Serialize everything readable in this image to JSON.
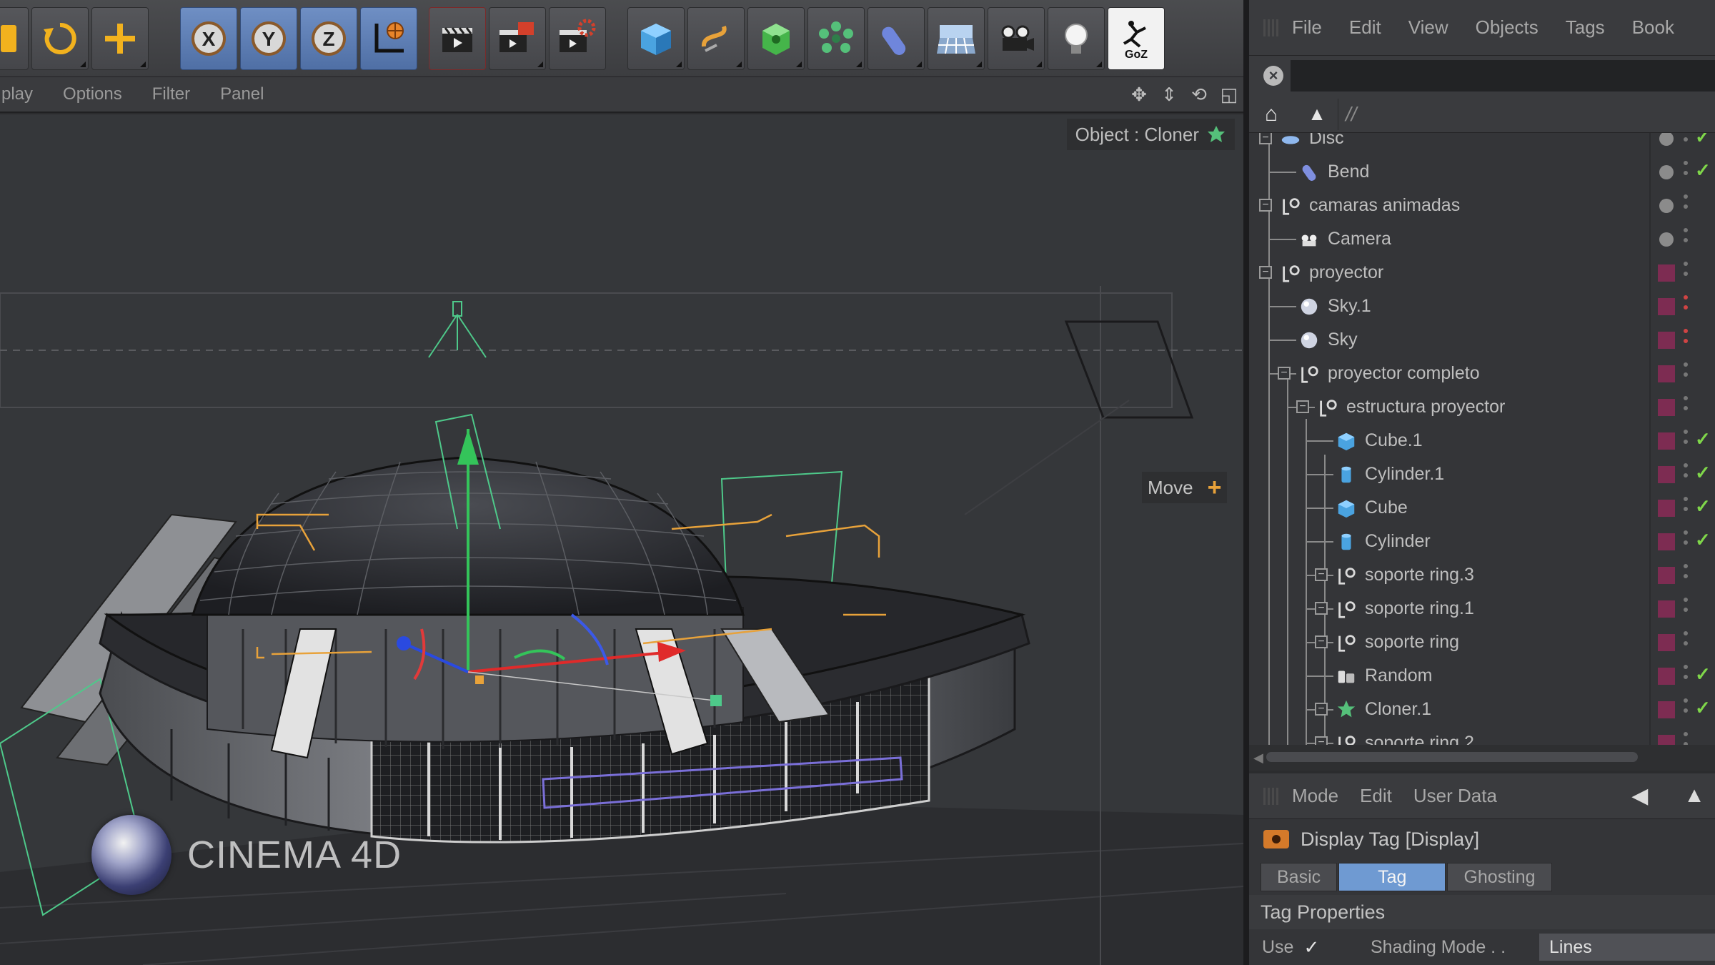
{
  "toolbar": {
    "groups": [
      {
        "items": [
          "model-tool-icon",
          "rotate-icon",
          "move-plus-icon"
        ]
      },
      {
        "items": [
          "x-axis-lock-icon",
          "y-axis-lock-icon",
          "z-axis-lock-icon",
          "world-coordinate-icon"
        ]
      },
      {
        "items": [
          "render-view-icon",
          "render-picture-viewer-icon",
          "render-settings-icon"
        ]
      },
      {
        "items": [
          "cube-object-icon",
          "spline-pen-icon",
          "nurbs-icon",
          "mograph-cloner-icon",
          "deformer-bend-icon",
          "scene-floor-icon",
          "camera-icon",
          "light-icon",
          "goz-icon"
        ]
      }
    ],
    "active_items": [
      "x-axis-lock-icon",
      "y-axis-lock-icon",
      "z-axis-lock-icon",
      "world-coordinate-icon"
    ],
    "goz_label": "GoZ"
  },
  "viewport_menu": {
    "items": [
      "play",
      "Options",
      "Filter",
      "Panel"
    ]
  },
  "viewport": {
    "object_label": "Object : Cloner",
    "hud_label": "Move",
    "logo_text": "CINEMA 4D"
  },
  "object_manager": {
    "menu": [
      "File",
      "Edit",
      "View",
      "Objects",
      "Tags",
      "Book"
    ],
    "path_text": "//",
    "rows": [
      {
        "name": "Disc",
        "icon": "disc-icon",
        "depth": 0,
        "expander": true,
        "layer": "dot",
        "check": true
      },
      {
        "name": "Bend",
        "icon": "bend-deformer-icon",
        "depth": 1,
        "expander": false,
        "layer": "dot",
        "check": true
      },
      {
        "name": "camaras animadas",
        "icon": "null-object-icon",
        "depth": 0,
        "expander": true,
        "layer": "dot",
        "check": false
      },
      {
        "name": "Camera",
        "icon": "camera-icon",
        "depth": 1,
        "expander": false,
        "layer": "dot",
        "check": false
      },
      {
        "name": "proyector",
        "icon": "null-object-icon",
        "depth": 0,
        "expander": true,
        "layer": "swatch",
        "check": false
      },
      {
        "name": "Sky.1",
        "icon": "sky-icon",
        "depth": 1,
        "expander": false,
        "layer": "swatch",
        "check": false,
        "red": true
      },
      {
        "name": "Sky",
        "icon": "sky-icon",
        "depth": 1,
        "expander": false,
        "layer": "swatch",
        "check": false,
        "red": true
      },
      {
        "name": "proyector completo",
        "icon": "null-object-icon",
        "depth": 1,
        "expander": true,
        "layer": "swatch",
        "check": false
      },
      {
        "name": "estructura proyector",
        "icon": "null-object-icon",
        "depth": 2,
        "expander": true,
        "layer": "swatch",
        "check": false
      },
      {
        "name": "Cube.1",
        "icon": "cube-icon",
        "depth": 3,
        "expander": false,
        "layer": "swatch",
        "check": true
      },
      {
        "name": "Cylinder.1",
        "icon": "cylinder-icon",
        "depth": 3,
        "expander": false,
        "layer": "swatch",
        "check": true
      },
      {
        "name": "Cube",
        "icon": "cube-icon",
        "depth": 3,
        "expander": false,
        "layer": "swatch",
        "check": true
      },
      {
        "name": "Cylinder",
        "icon": "cylinder-icon",
        "depth": 3,
        "expander": false,
        "layer": "swatch",
        "check": true
      },
      {
        "name": "soporte ring.3",
        "icon": "null-object-icon",
        "depth": 3,
        "expander": true,
        "layer": "swatch",
        "check": false
      },
      {
        "name": "soporte ring.1",
        "icon": "null-object-icon",
        "depth": 3,
        "expander": true,
        "layer": "swatch",
        "check": false
      },
      {
        "name": "soporte ring",
        "icon": "null-object-icon",
        "depth": 3,
        "expander": true,
        "layer": "swatch",
        "check": false
      },
      {
        "name": "Random",
        "icon": "random-effector-icon",
        "depth": 3,
        "expander": false,
        "layer": "swatch",
        "check": true
      },
      {
        "name": "Cloner.1",
        "icon": "cloner-icon",
        "depth": 3,
        "expander": true,
        "layer": "swatch",
        "check": true
      },
      {
        "name": "soporte ring.2",
        "icon": "null-object-icon",
        "depth": 3,
        "expander": true,
        "layer": "swatch",
        "check": false
      }
    ]
  },
  "attribute_manager": {
    "menu": [
      "Mode",
      "Edit",
      "User Data"
    ],
    "title": "Display Tag [Display]",
    "tabs": [
      "Basic",
      "Tag",
      "Ghosting"
    ],
    "active_tab": "Tag",
    "section": "Tag Properties",
    "use_label": "Use",
    "use_checked": "✓",
    "shading_label": "Shading Mode . .",
    "shading_value": "Lines"
  },
  "colors": {
    "accent_blue": "#6f9ad2",
    "layer_swatch": "#7d2c52",
    "check_green": "#7fd64a",
    "wire_orange": "#e8a23a"
  }
}
